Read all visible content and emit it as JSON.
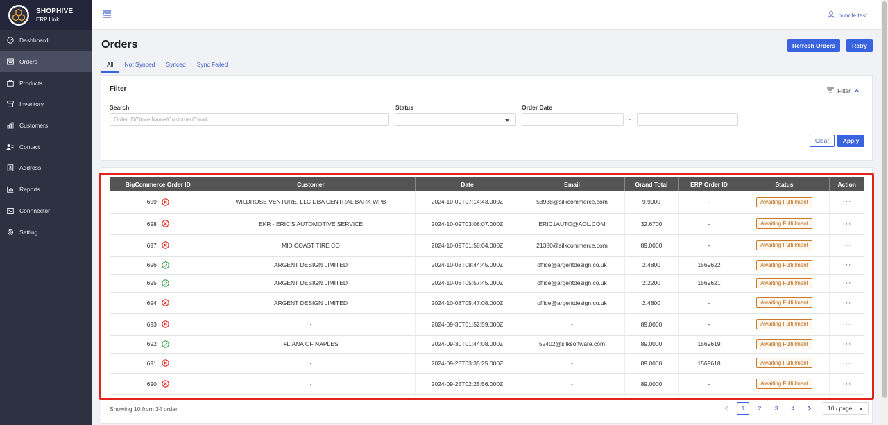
{
  "brand": {
    "name": "SHOPHIVE",
    "subtitle": "ERP Link"
  },
  "sidebar": {
    "items": [
      {
        "label": "Dashboard",
        "icon": "dashboard-icon",
        "active": false
      },
      {
        "label": "Orders",
        "icon": "orders-icon",
        "active": true
      },
      {
        "label": "Products",
        "icon": "products-icon",
        "active": false
      },
      {
        "label": "Inventory",
        "icon": "inventory-icon",
        "active": false
      },
      {
        "label": "Customers",
        "icon": "customers-icon",
        "active": false
      },
      {
        "label": "Contact",
        "icon": "contact-icon",
        "active": false
      },
      {
        "label": "Address",
        "icon": "address-icon",
        "active": false
      },
      {
        "label": "Reports",
        "icon": "reports-icon",
        "active": false
      },
      {
        "label": "Connnector",
        "icon": "connector-icon",
        "active": false
      },
      {
        "label": "Setting",
        "icon": "gear-icon",
        "active": false
      }
    ]
  },
  "header": {
    "user": "bundle test"
  },
  "page": {
    "title": "Orders",
    "refresh_label": "Refresh Orders",
    "retry_label": "Retry",
    "tabs": [
      "All",
      "Not Synced",
      "Synced",
      "Sync Failed"
    ]
  },
  "filter": {
    "title": "Filter",
    "toggle_label": "Filter",
    "search_label": "Search",
    "search_placeholder": "Order ID/Store Name/Customer/Email",
    "status_label": "Status",
    "date_label": "Order Date",
    "date_separator": "-",
    "clear_label": "Clear",
    "apply_label": "Apply"
  },
  "table": {
    "columns": [
      "BigCommerce Order ID",
      "Customer",
      "Date",
      "Email",
      "Grand Total",
      "ERP Order ID",
      "Status",
      "Action"
    ],
    "action_glyph": "···",
    "rows": [
      {
        "id": "699",
        "synced": false,
        "customer": "WILDROSE VENTURE, LLC DBA CENTRAL BARK WPB",
        "date": "2024-10-09T07:14:43.000Z",
        "email": "53938@silkcommerce.com",
        "total": "9.9900",
        "erp": "-",
        "status": "Awaiting Fulfillment"
      },
      {
        "id": "698",
        "synced": false,
        "customer": "EKR - ERIC'S AUTOMOTIVE SERVICE",
        "date": "2024-10-09T03:08:07.000Z",
        "email": "ERIC1AUTO@AOL.COM",
        "total": "32.6700",
        "erp": "-",
        "status": "Awaiting Fulfillment"
      },
      {
        "id": "697",
        "synced": false,
        "customer": "MID COAST TIRE CO",
        "date": "2024-10-09T01:58:04.000Z",
        "email": "21380@silkcommerce.com",
        "total": "89.0000",
        "erp": "-",
        "status": "Awaiting Fulfillment"
      },
      {
        "id": "696",
        "synced": true,
        "customer": "ARGENT DESIGN LIMITED",
        "date": "2024-10-08T08:44:45.000Z",
        "email": "office@argentdesign.co.uk",
        "total": "2.4800",
        "erp": "1569622",
        "status": "Awaiting Fulfillment"
      },
      {
        "id": "695",
        "synced": true,
        "customer": "ARGENT DESIGN LIMITED",
        "date": "2024-10-08T05:57:45.000Z",
        "email": "office@argentdesign.co.uk",
        "total": "2.2200",
        "erp": "1569621",
        "status": "Awaiting Fulfillment"
      },
      {
        "id": "694",
        "synced": false,
        "customer": "ARGENT DESIGN LIMITED",
        "date": "2024-10-08T05:47:08.000Z",
        "email": "office@argentdesign.co.uk",
        "total": "2.4800",
        "erp": "-",
        "status": "Awaiting Fulfillment"
      },
      {
        "id": "693",
        "synced": false,
        "customer": "-",
        "date": "2024-09-30T01:52:59.000Z",
        "email": "-",
        "total": "89.0000",
        "erp": "-",
        "status": "Awaiting Fulfillment"
      },
      {
        "id": "692",
        "synced": true,
        "customer": "+LIANA OF NAPLES",
        "date": "2024-09-30T01:44:08.000Z",
        "email": "52402@silksoftware.com",
        "total": "89.0000",
        "erp": "1569619",
        "status": "Awaiting Fulfillment"
      },
      {
        "id": "691",
        "synced": false,
        "customer": "-",
        "date": "2024-09-25T03:35:25.000Z",
        "email": "-",
        "total": "89.0000",
        "erp": "1569618",
        "status": "Awaiting Fulfillment"
      },
      {
        "id": "690",
        "synced": false,
        "customer": "-",
        "date": "2024-09-25T02:25:56.000Z",
        "email": "-",
        "total": "89.0000",
        "erp": "-",
        "status": "Awaiting Fulfillment"
      }
    ]
  },
  "footer": {
    "showing": "Showing 10 from 34 order",
    "pages": [
      "1",
      "2",
      "3",
      "4"
    ],
    "current_page": "1",
    "page_size": "10 / page"
  },
  "colors": {
    "sidebar_bg": "#2d3142",
    "primary": "#3a63e0",
    "error": "#e3231b",
    "success": "#2e9e3e",
    "badge": "#c97a2d"
  }
}
